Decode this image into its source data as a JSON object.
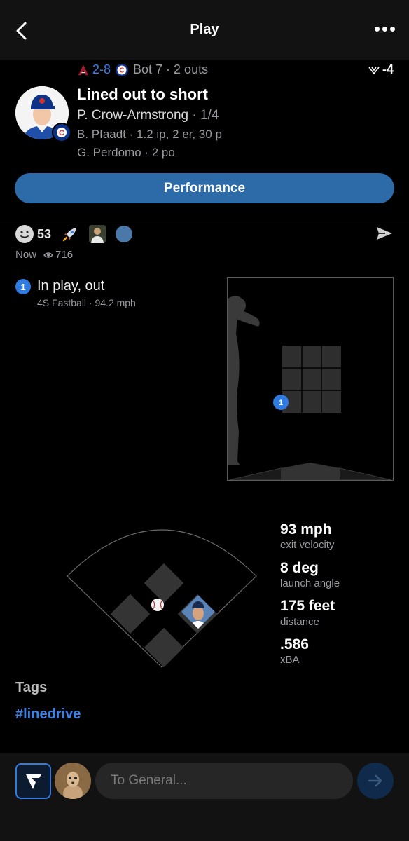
{
  "header": {
    "title": "Play",
    "back_icon": "chevron-left-icon",
    "more_icon": "more-horizontal-icon"
  },
  "game": {
    "score": "2-8",
    "inning": "Bot 7 · 2 outs",
    "wpa": "-4"
  },
  "play": {
    "title": "Lined out to short",
    "batter": "P. Crow-Armstrong",
    "batter_stat": " · 1/4",
    "pitcher": "B. Pfaadt · 1.2 ip, 2 er, 30 p",
    "fielder": "G. Perdomo · 2 po"
  },
  "performance_button": "Performance",
  "reactions": {
    "count": "53"
  },
  "meta": {
    "time": "Now",
    "views": "716"
  },
  "pitch": {
    "number": "1",
    "result": "In play, out",
    "type": "4S Fastball ·  94.2 mph",
    "zone_label": "1"
  },
  "stats": [
    {
      "value": "93 mph",
      "label": "exit velocity"
    },
    {
      "value": "8 deg",
      "label": "launch angle"
    },
    {
      "value": "175 feet",
      "label": "distance"
    },
    {
      "value": ".586",
      "label": "xBA"
    }
  ],
  "tags": {
    "title": "Tags",
    "items": [
      "#linedrive"
    ]
  },
  "compose": {
    "placeholder": "To General..."
  },
  "colors": {
    "accent": "#3b82e6",
    "button": "#2d6aa8",
    "background": "#000000"
  }
}
